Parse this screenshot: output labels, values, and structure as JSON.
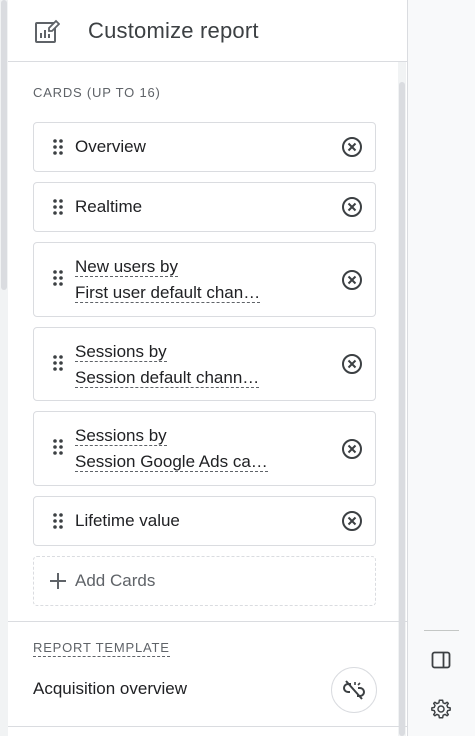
{
  "header": {
    "title": "Customize report",
    "icon": "report-edit-icon"
  },
  "cards_section": {
    "label": "CARDS (UP TO 16)"
  },
  "cards": [
    {
      "line1": "Overview",
      "line2": ""
    },
    {
      "line1": "Realtime",
      "line2": ""
    },
    {
      "line1": "New users by",
      "line2": "First user default chan…"
    },
    {
      "line1": "Sessions by",
      "line2": "Session default chann…"
    },
    {
      "line1": "Sessions by",
      "line2": "Session Google Ads ca…"
    },
    {
      "line1": "Lifetime value",
      "line2": ""
    }
  ],
  "add_cards": {
    "label": "Add Cards"
  },
  "template_section": {
    "label": "REPORT TEMPLATE",
    "name": "Acquisition overview"
  },
  "colors": {
    "border": "#dadce0",
    "text": "#202124",
    "muted": "#5f6368"
  }
}
